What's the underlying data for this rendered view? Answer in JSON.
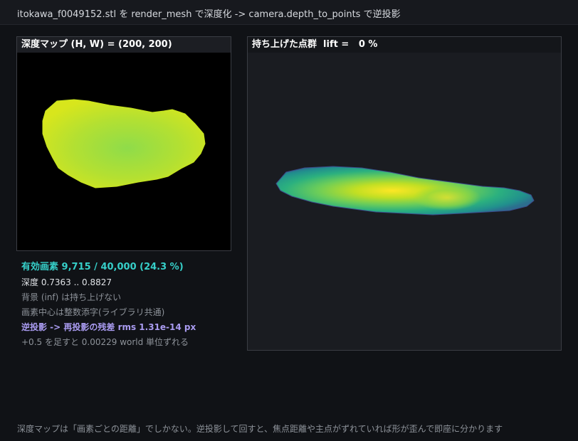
{
  "header": {
    "title": "itokawa_f0049152.stl を render_mesh で深度化 -> camera.depth_to_points で逆投影"
  },
  "depth_panel": {
    "label": "深度マップ (H, W) = (200, 200)"
  },
  "points_panel": {
    "label_prefix": "持ち上げた点群  lift = ",
    "lift_value": "  0 %"
  },
  "stats": {
    "valid_pixels": "有効画素 9,715 / 40,000 (24.3 %)",
    "depth_range": "深度 0.7363 .. 0.8827",
    "background_note": "背景 (inf) は持ち上げない",
    "pixel_center_note": "画素中心は整数添字(ライブラリ共通)",
    "reprojection_residual": "逆投影 -> 再投影の残差 rms 1.31e-14 px",
    "offset_note": "+0.5 を足すと 0.00229 world 単位ずれる"
  },
  "footer": {
    "text": "深度マップは「画素ごとの距離」でしかない。逆投影して回すと、焦点距離や主点がずれていれば形が歪んで即座に分かります"
  },
  "colors": {
    "valid_accent": "#36cfc9",
    "reproj_accent": "#a99bf0",
    "depth_near": "#c8e020",
    "depth_far": "#a0dc40",
    "points_core": "#fde725",
    "points_mid": "#35b779",
    "points_edge": "#31688e"
  }
}
